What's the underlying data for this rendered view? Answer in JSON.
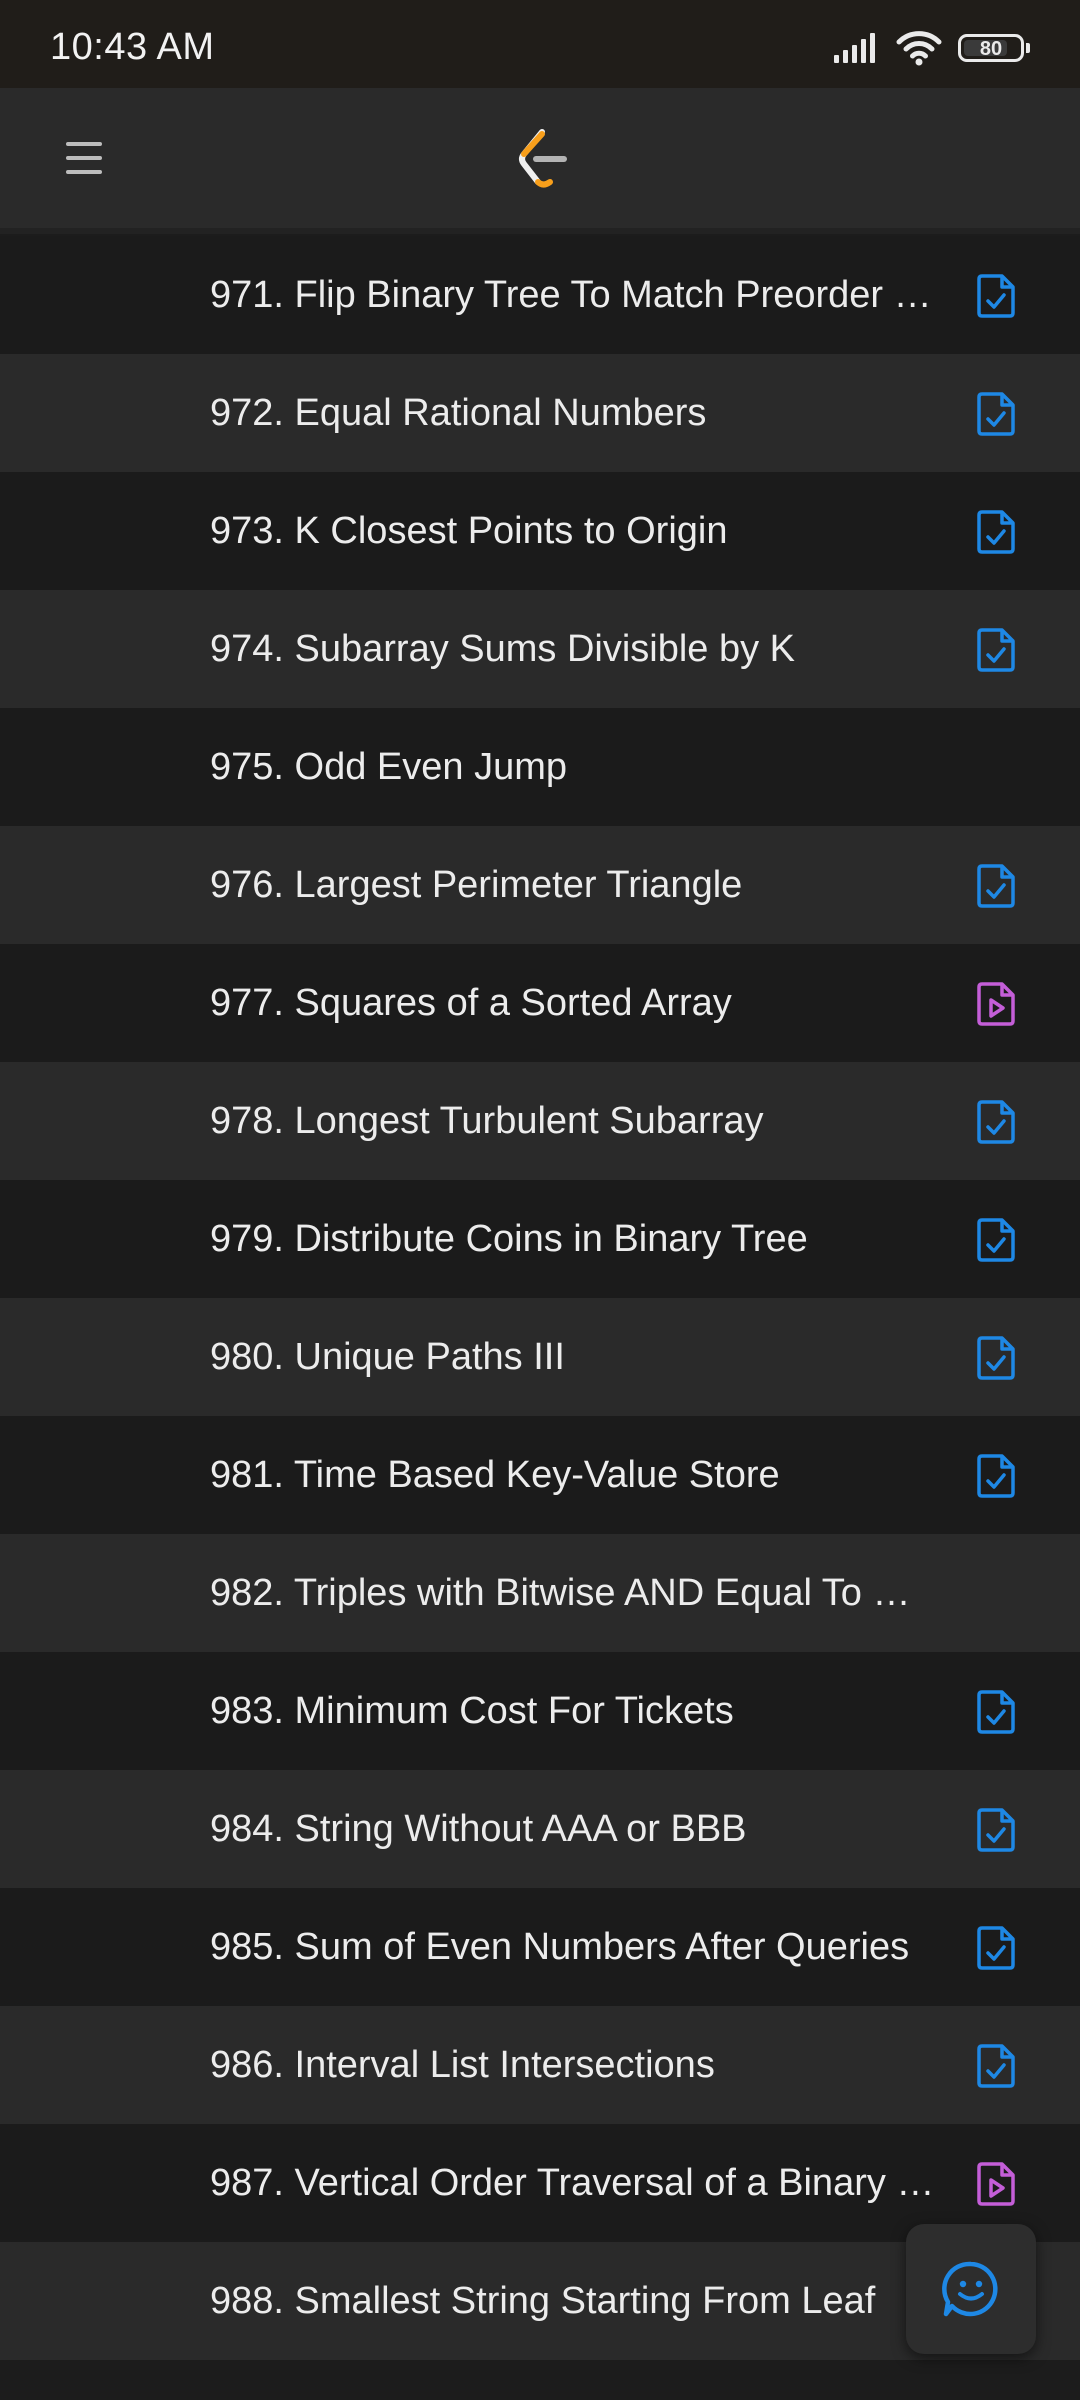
{
  "status_bar": {
    "time": "10:43 AM",
    "battery": "80",
    "battery_level": 0.8
  },
  "header": {
    "menu_icon": "hamburger-menu-icon",
    "logo": "leetcode-logo"
  },
  "colors": {
    "solution_icon": "#1e88e5",
    "video_icon": "#c45ed8",
    "row_dark": "#1b1b1b",
    "row_light": "#2a2a2a"
  },
  "problems": [
    {
      "title": "971. Flip Binary Tree To Match Preorder …",
      "icon": "solution-doc-icon"
    },
    {
      "title": "972. Equal Rational Numbers",
      "icon": "solution-doc-icon"
    },
    {
      "title": "973. K Closest Points to Origin",
      "icon": "solution-doc-icon"
    },
    {
      "title": "974. Subarray Sums Divisible by K",
      "icon": "solution-doc-icon"
    },
    {
      "title": "975. Odd Even Jump",
      "icon": ""
    },
    {
      "title": "976. Largest Perimeter Triangle",
      "icon": "solution-doc-icon"
    },
    {
      "title": "977. Squares of a Sorted Array",
      "icon": "video-solution-icon"
    },
    {
      "title": "978. Longest Turbulent Subarray",
      "icon": "solution-doc-icon"
    },
    {
      "title": "979. Distribute Coins in Binary Tree",
      "icon": "solution-doc-icon"
    },
    {
      "title": "980. Unique Paths III",
      "icon": "solution-doc-icon"
    },
    {
      "title": "981. Time Based Key-Value Store",
      "icon": "solution-doc-icon"
    },
    {
      "title": "982. Triples with Bitwise AND Equal To …",
      "icon": ""
    },
    {
      "title": "983. Minimum Cost For Tickets",
      "icon": "solution-doc-icon"
    },
    {
      "title": "984. String Without AAA or BBB",
      "icon": "solution-doc-icon"
    },
    {
      "title": "985. Sum of Even Numbers After Queries",
      "icon": "solution-doc-icon"
    },
    {
      "title": "986. Interval List Intersections",
      "icon": "solution-doc-icon"
    },
    {
      "title": "987. Vertical Order Traversal of a Binary …",
      "icon": "video-solution-icon"
    },
    {
      "title": "988. Smallest String Starting From Leaf",
      "icon": ""
    }
  ],
  "fab": {
    "icon": "feedback-smiley-icon"
  }
}
